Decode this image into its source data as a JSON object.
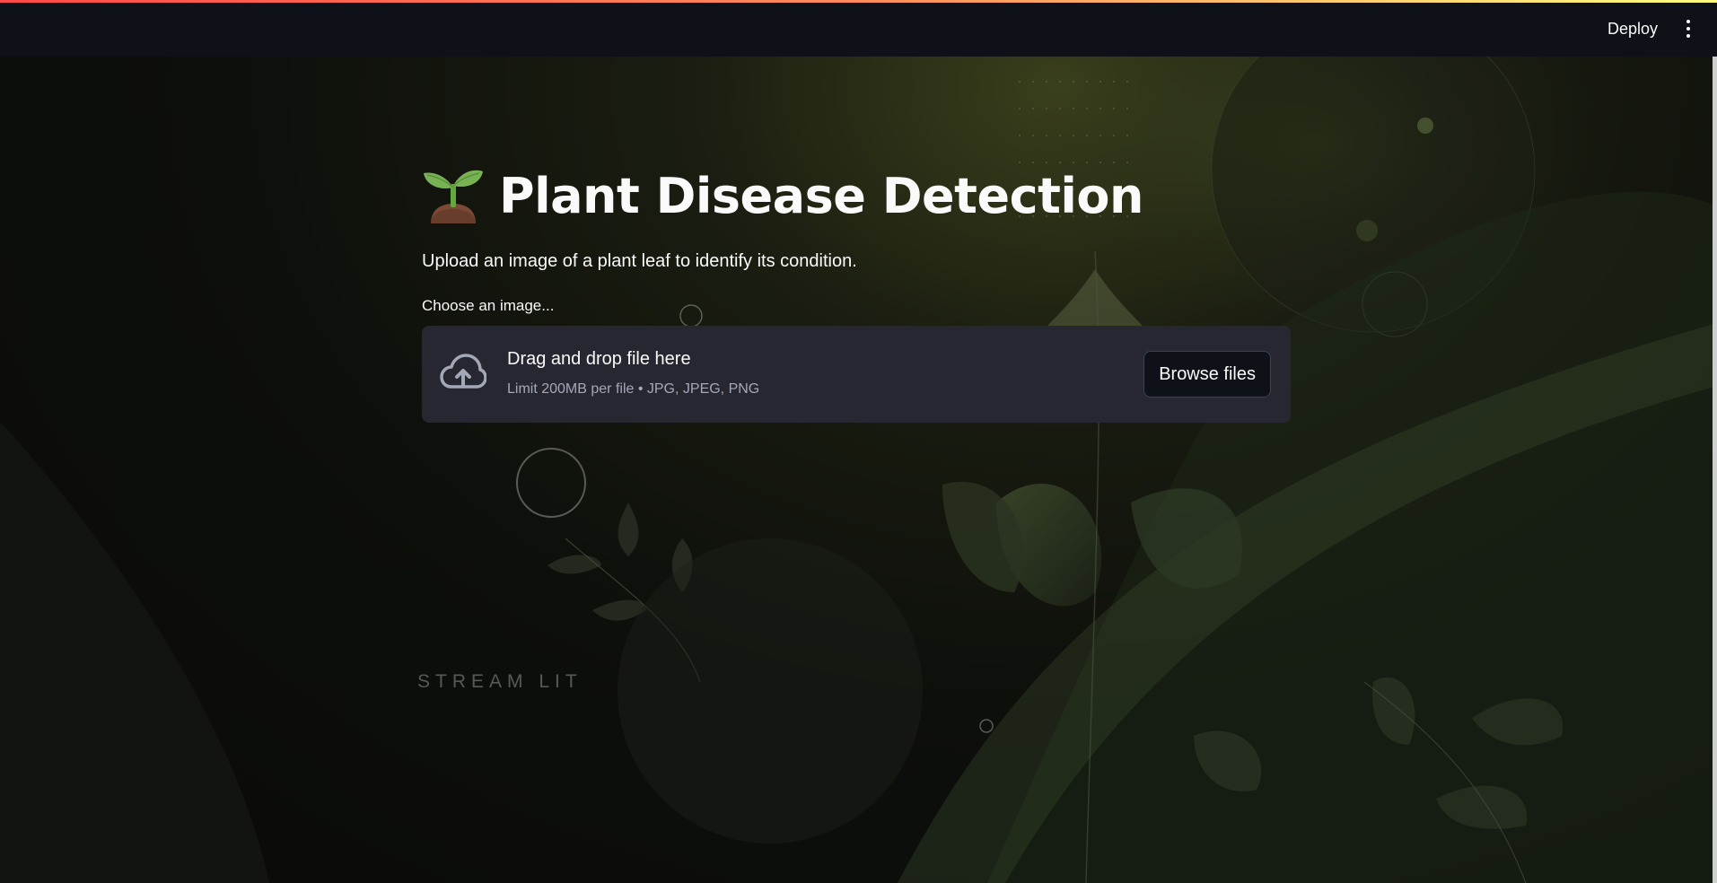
{
  "header": {
    "deploy_label": "Deploy",
    "menu_icon": "kebab-menu-icon"
  },
  "main": {
    "title_icon": "seedling-icon",
    "title": "Plant Disease Detection",
    "subtitle": "Upload an image of a plant leaf to identify its condition.",
    "uploader": {
      "label": "Choose an image...",
      "icon": "cloud-upload-icon",
      "drop_text": "Drag and drop file here",
      "limit_text": "Limit 200MB per file • JPG, JPEG, PNG",
      "browse_label": "Browse files"
    }
  },
  "background": {
    "watermark": "STREAM LIT"
  },
  "colors": {
    "header_bg": "#0e1117",
    "dropzone_bg": "#262730",
    "text": "#fafafa",
    "muted_text": "#a3a8b8",
    "accent_gradient": [
      "#ff4b4b",
      "#fffd80"
    ]
  }
}
